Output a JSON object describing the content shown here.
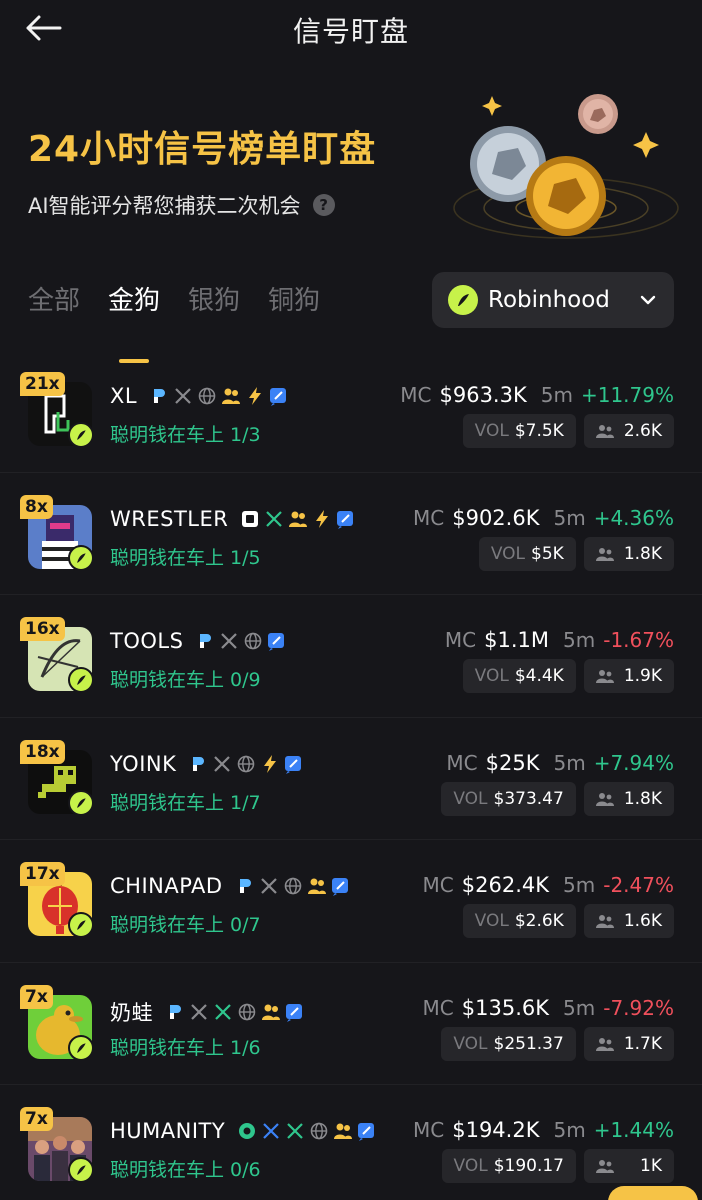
{
  "header": {
    "title": "信号盯盘",
    "back_icon": "arrow-left-icon"
  },
  "hero": {
    "title": "24小时信号榜单盯盘",
    "subtitle": "AI智能评分帮您捕获二次机会",
    "help": "?",
    "accent": "#f6c346"
  },
  "tabs": [
    {
      "label": "全部",
      "active": false
    },
    {
      "label": "金狗",
      "active": true
    },
    {
      "label": "银狗",
      "active": false
    },
    {
      "label": "铜狗",
      "active": false
    }
  ],
  "chain_selector": {
    "label": "Robinhood",
    "logo_color": "#c7f24a"
  },
  "tokens": [
    {
      "mult": "21x",
      "name": "XL",
      "smart": "聪明钱在车上 1/3",
      "mc_label": "MC",
      "mc": "$963.3K",
      "time": "5m",
      "change": "+11.79%",
      "dir": "up",
      "vol_label": "VOL",
      "vol": "$7.5K",
      "holders": "2.6K",
      "avatar": "xl"
    },
    {
      "mult": "8x",
      "name": "WRESTLER",
      "smart": "聪明钱在车上 1/5",
      "mc_label": "MC",
      "mc": "$902.6K",
      "time": "5m",
      "change": "+4.36%",
      "dir": "up",
      "vol_label": "VOL",
      "vol": "$5K",
      "holders": "1.8K",
      "avatar": "wrestler"
    },
    {
      "mult": "16x",
      "name": "TOOLS",
      "smart": "聪明钱在车上 0/9",
      "mc_label": "MC",
      "mc": "$1.1M",
      "time": "5m",
      "change": "-1.67%",
      "dir": "down",
      "vol_label": "VOL",
      "vol": "$4.4K",
      "holders": "1.9K",
      "avatar": "tools"
    },
    {
      "mult": "18x",
      "name": "YOINK",
      "smart": "聪明钱在车上 1/7",
      "mc_label": "MC",
      "mc": "$25K",
      "time": "5m",
      "change": "+7.94%",
      "dir": "up",
      "vol_label": "VOL",
      "vol": "$373.47",
      "holders": "1.8K",
      "avatar": "yoink"
    },
    {
      "mult": "17x",
      "name": "CHINAPAD",
      "smart": "聪明钱在车上 0/7",
      "mc_label": "MC",
      "mc": "$262.4K",
      "time": "5m",
      "change": "-2.47%",
      "dir": "down",
      "vol_label": "VOL",
      "vol": "$2.6K",
      "holders": "1.6K",
      "avatar": "chinapad"
    },
    {
      "mult": "7x",
      "name": "奶蛙",
      "smart": "聪明钱在车上 1/6",
      "mc_label": "MC",
      "mc": "$135.6K",
      "time": "5m",
      "change": "-7.92%",
      "dir": "down",
      "vol_label": "VOL",
      "vol": "$251.37",
      "holders": "1.7K",
      "avatar": "frog"
    },
    {
      "mult": "7x",
      "name": "HUMANITY",
      "smart": "聪明钱在车上 0/6",
      "mc_label": "MC",
      "mc": "$194.2K",
      "time": "5m",
      "change": "+1.44%",
      "dir": "up",
      "vol_label": "VOL",
      "vol": "$190.17",
      "holders": "1K",
      "avatar": "humanity"
    }
  ],
  "colors": {
    "up": "#2fc68d",
    "down": "#f0505c",
    "smart_money": "#2fc68d"
  }
}
